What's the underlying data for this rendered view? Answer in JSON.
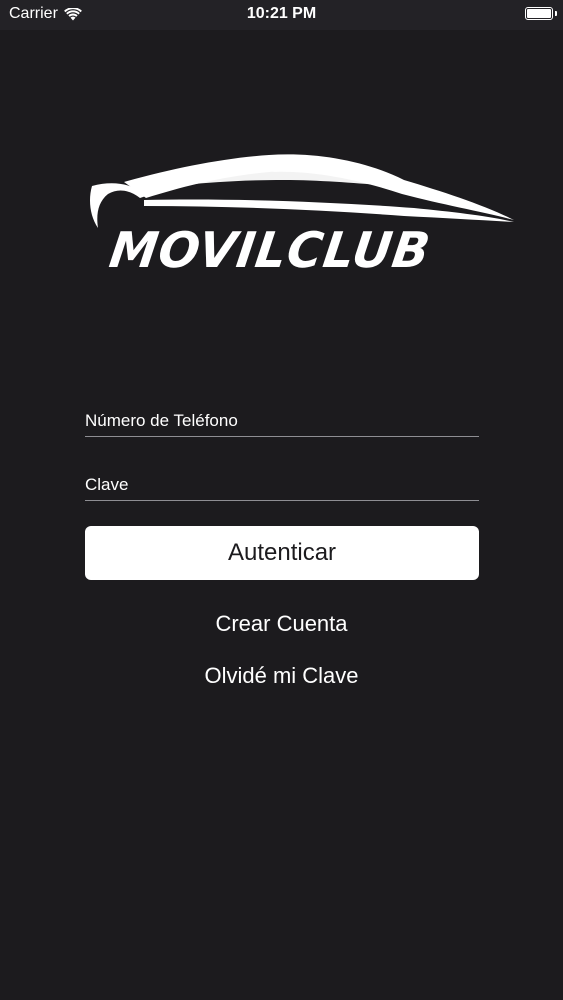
{
  "status_bar": {
    "carrier": "Carrier",
    "time": "10:21 PM",
    "wifi_icon": "wifi-icon",
    "battery_icon": "battery-icon",
    "battery_level": 1.0
  },
  "logo": {
    "text": "MOVILCLUB",
    "icon": "car-silhouette-icon"
  },
  "login_form": {
    "phone_placeholder": "Número de Teléfono",
    "phone_value": "",
    "password_placeholder": "Clave",
    "password_value": "",
    "submit_label": "Autenticar"
  },
  "links": {
    "create_account": "Crear Cuenta",
    "forgot_password": "Olvidé mi Clave"
  },
  "colors": {
    "background": "#1c1b1e",
    "status_bar": "#232226",
    "button_background": "#ffffff",
    "button_text": "#1c1b1e",
    "text": "#ffffff",
    "field_underline": "#8e8e93"
  }
}
